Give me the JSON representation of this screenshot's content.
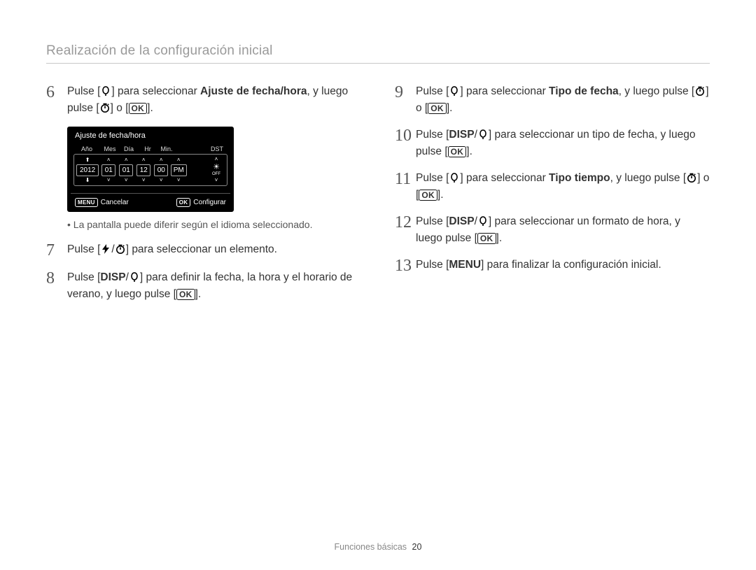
{
  "page_title": "Realización de la configuración inicial",
  "footer": {
    "section": "Funciones básicas",
    "page_number": "20"
  },
  "buttons": {
    "ok": "OK",
    "menu": "MENU",
    "disp": "DISP"
  },
  "bold_terms": {
    "ajuste_fecha_hora": "Ajuste de fecha/hora",
    "tipo_de_fecha": "Tipo de fecha",
    "tipo_tiempo": "Tipo tiempo"
  },
  "steps": {
    "s6a": "Pulse [",
    "s6b": "] para seleccionar ",
    "s6c": ", y luego pulse [",
    "s6d": "] o [",
    "s6e": "].",
    "s7a": "Pulse [",
    "s7b": "/",
    "s7c": "] para seleccionar un elemento.",
    "s8a": "Pulse [",
    "s8b": "/",
    "s8c": "] para definir la fecha, la hora y el horario de verano, y luego pulse [",
    "s8d": "].",
    "s9a": "Pulse [",
    "s9b": "] para seleccionar ",
    "s9c": ", y luego pulse [",
    "s9d": "] o [",
    "s9e": "].",
    "s10a": "Pulse [",
    "s10b": "/",
    "s10c": "] para seleccionar un tipo de fecha, y luego pulse [",
    "s10d": "].",
    "s11a": "Pulse [",
    "s11b": "] para seleccionar ",
    "s11c": ", y luego pulse [",
    "s11d": "] o [",
    "s11e": "].",
    "s12a": "Pulse [",
    "s12b": "/",
    "s12c": "] para seleccionar un formato de hora, y luego pulse [",
    "s12d": "].",
    "s13a": "Pulse [",
    "s13b": "] para finalizar la configuración inicial."
  },
  "lcd": {
    "title": "Ajuste de fecha/hora",
    "headers": {
      "year": "Año",
      "month": "Mes",
      "day": "Día",
      "hr": "Hr",
      "min": "Min.",
      "dst": "DST"
    },
    "values": {
      "year": "2012",
      "month": "01",
      "day": "01",
      "hr": "12",
      "min": "00",
      "ampm": "PM"
    },
    "dst_off": "OFF",
    "footer": {
      "cancel": "Cancelar",
      "set": "Configurar"
    }
  },
  "note": "La pantalla puede diferir según el idioma seleccionado.",
  "step_numbers": {
    "n6": "6",
    "n7": "7",
    "n8": "8",
    "n9": "9",
    "n10": "10",
    "n11": "11",
    "n12": "12",
    "n13": "13"
  }
}
